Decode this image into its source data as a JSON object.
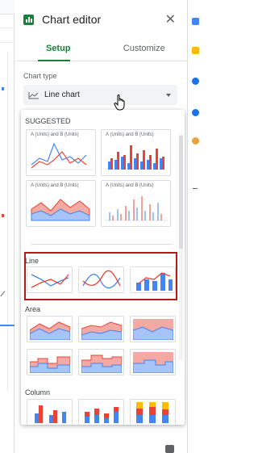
{
  "panel": {
    "title": "Chart editor",
    "tabs": [
      "Setup",
      "Customize"
    ],
    "chart_type_label": "Chart type",
    "chart_type_value": "Line chart"
  },
  "dropdown": {
    "suggested_label": "SUGGESTED",
    "suggestion_captions": [
      "A (Units) and B (Units)",
      "A (Units) and B (Units)",
      "A (Units) and B (Units)",
      "A (Units) and B (Units)"
    ],
    "groups": [
      "Line",
      "Area",
      "Column"
    ]
  },
  "colors": {
    "accent_green": "#188038",
    "series_blue": "#4285f4",
    "series_red": "#ea4335",
    "series_yellow": "#fbbc04",
    "highlight_red": "#b31b1b"
  },
  "icons": [
    "chart-editor-icon",
    "close-icon",
    "line-chart-icon",
    "dropdown-caret-icon",
    "hand-cursor-icon"
  ]
}
